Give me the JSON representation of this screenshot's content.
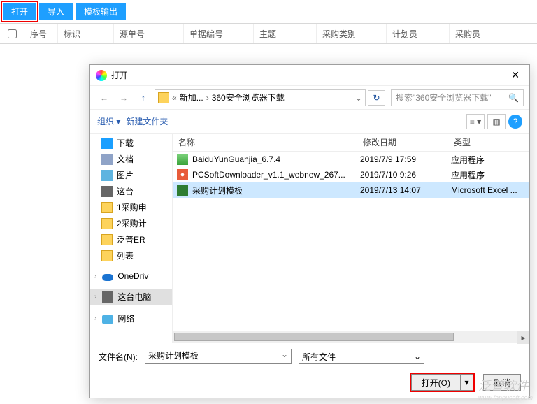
{
  "toolbar": {
    "open": "打开",
    "import": "导入",
    "templateExport": "模板输出"
  },
  "grid": {
    "col_seq": "序号",
    "col_flag": "标识",
    "col_source": "源单号",
    "col_docno": "单据编号",
    "col_subject": "主题",
    "col_category": "采购类别",
    "col_planner": "计划员",
    "col_buyer": "采购员"
  },
  "dialog": {
    "title": "打开",
    "nav": {
      "crumb1": "新加...",
      "crumb2": "360安全浏览器下载",
      "searchPlaceholder": "搜索\"360安全浏览器下载\"",
      "sep": "›",
      "sep2": "«"
    },
    "org": {
      "organize": "组织",
      "newFolder": "新建文件夹"
    },
    "tree": {
      "downloads": "下载",
      "docs": "文档",
      "pics": "图片",
      "thisPc": "这台",
      "f1": "1采购申",
      "f2": "2采购计",
      "fp": "泛普ER",
      "list": "列表",
      "onedrive": "OneDriv",
      "thisPcFull": "这台电脑",
      "network": "网络"
    },
    "filehead": {
      "name": "名称",
      "mod": "修改日期",
      "type": "类型"
    },
    "files": [
      {
        "icon": "exe",
        "name": "BaiduYunGuanjia_6.7.4",
        "date": "2019/7/9 17:59",
        "type": "应用程序"
      },
      {
        "icon": "web",
        "name": "PCSoftDownloader_v1.1_webnew_267...",
        "date": "2019/7/10 9:26",
        "type": "应用程序"
      },
      {
        "icon": "xls",
        "name": "采购计划模板",
        "date": "2019/7/13 14:07",
        "type": "Microsoft Excel ...",
        "selected": true
      }
    ],
    "footer": {
      "filenameLabel": "文件名(N):",
      "filenameValue": "采购计划模板",
      "typeFilter": "所有文件",
      "openBtn": "打开(O)",
      "cancelBtn": "取消"
    }
  },
  "watermark": {
    "brand": "泛普软件",
    "url": "www.fanpusoft.com"
  }
}
